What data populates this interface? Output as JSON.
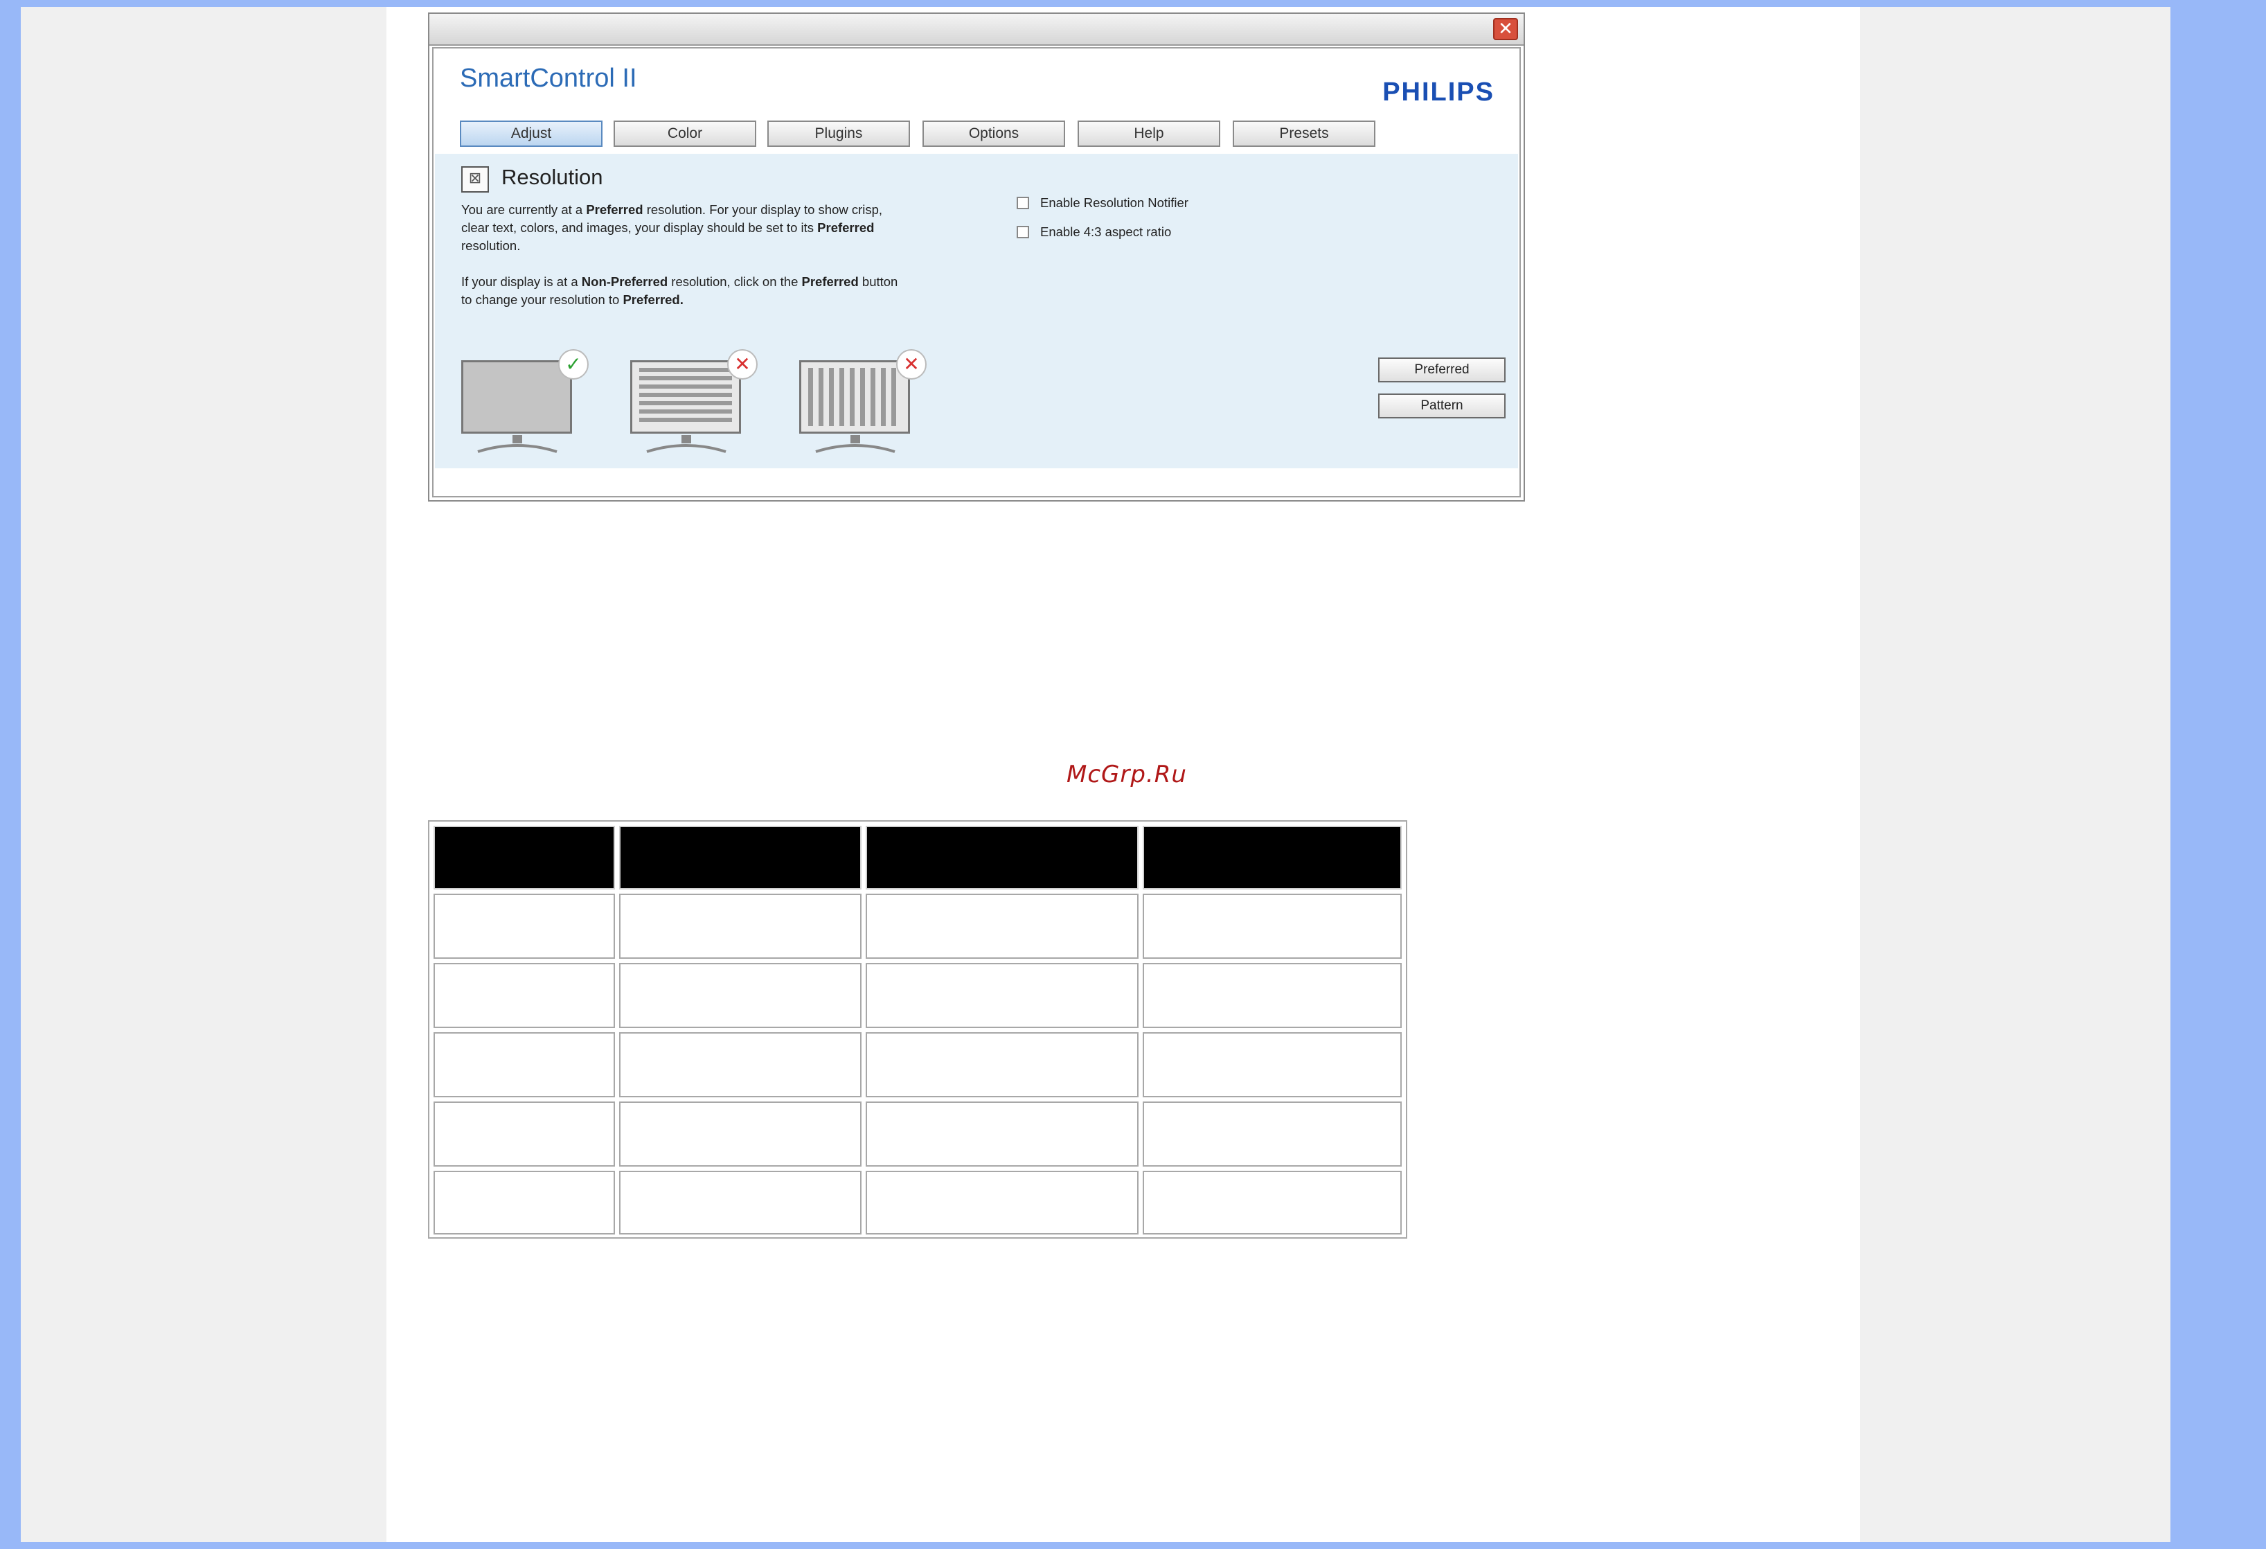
{
  "window": {
    "app_title": "SmartControl II",
    "brand": "PHILIPS",
    "close_glyph": "✕"
  },
  "tabs": [
    {
      "label": "Adjust",
      "active": true
    },
    {
      "label": "Color",
      "active": false
    },
    {
      "label": "Plugins",
      "active": false
    },
    {
      "label": "Options",
      "active": false
    },
    {
      "label": "Help",
      "active": false
    },
    {
      "label": "Presets",
      "active": false
    }
  ],
  "resolution": {
    "icon": "resolution-icon",
    "title": "Resolution",
    "para1": {
      "t1": "You are currently at a ",
      "b1": "Preferred",
      "t2": " resolution. For your display to show crisp, clear text, colors, and images, your display should be set to its ",
      "b2": "Preferred",
      "t3": " resolution."
    },
    "para2": {
      "t1": "If your display is at a ",
      "b1": "Non-Preferred",
      "t2": " resolution, click on the ",
      "b2": "Preferred",
      "t3": " button to change your resolution to ",
      "b3": "Preferred."
    },
    "checkboxes": [
      {
        "label": "Enable Resolution Notifier",
        "checked": false
      },
      {
        "label": "Enable 4:3 aspect ratio",
        "checked": false
      }
    ],
    "buttons": {
      "preferred": "Preferred",
      "pattern": "Pattern"
    },
    "badges": {
      "ok": "✓",
      "no": "✕"
    }
  },
  "watermark": "McGrp.Ru",
  "colors": {
    "page_bg": "#98b8f8",
    "title_blue": "#2c6bb6",
    "brand_blue": "#1a4fb3",
    "panel_bg": "#e4f0f8"
  }
}
